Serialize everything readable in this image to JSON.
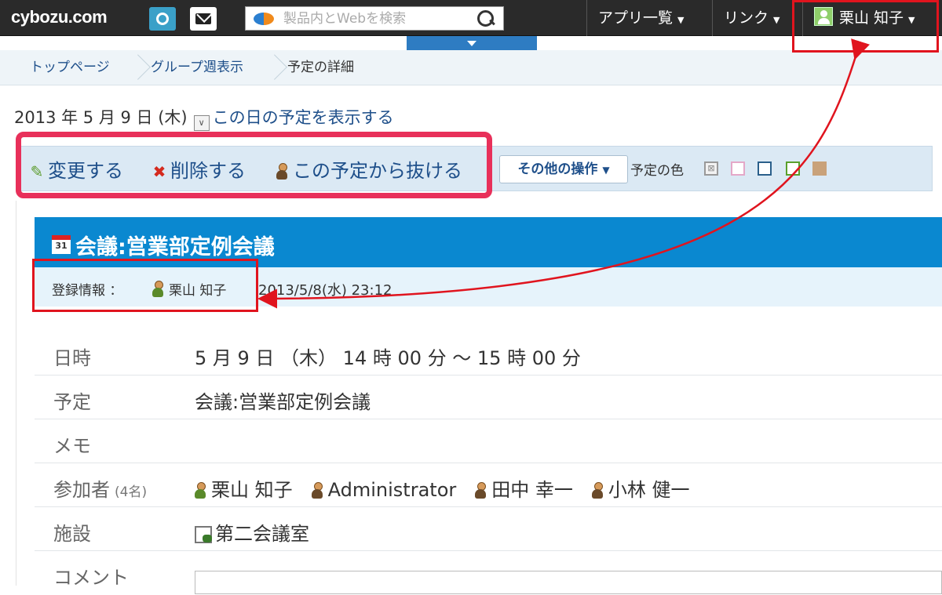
{
  "topbar": {
    "logo": "cybozu.com",
    "search_placeholder": "製品内とWebを検索",
    "nav_apps": "アプリ一覧",
    "nav_links": "リンク",
    "user_name": "栗山 知子"
  },
  "breadcrumb": {
    "items": [
      "トップページ",
      "グループ週表示",
      "予定の詳細"
    ]
  },
  "date_header": {
    "date": "2013 年 5 月 9 日 (木)",
    "show_day_link": "この日の予定を表示する"
  },
  "toolbar": {
    "edit": "変更する",
    "delete": "削除する",
    "leave": "この予定から抜ける",
    "other_ops": "その他の操作",
    "color_label": "予定の色",
    "colors": [
      "#e4a8c8",
      "#2a5f8a",
      "#5aa02c",
      "#c9a27a"
    ]
  },
  "schedule": {
    "title": "会議:営業部定例会議",
    "calendar_icon_text": "31",
    "registration_label": "登録情報 ：",
    "registrant": "栗山 知子",
    "registered_at": "2013/5/8(水) 23:12",
    "fields": {
      "datetime_label": "日時",
      "datetime_value": "5 月 9 日 （木） 14 時 00 分 ～ 15 時 00 分",
      "plan_label": "予定",
      "plan_value": "会議:営業部定例会議",
      "memo_label": "メモ",
      "memo_value": "",
      "participants_label": "参加者",
      "participants_count": "(4名)",
      "participants": [
        "栗山 知子",
        "Administrator",
        "田中 幸一",
        "小林 健一"
      ],
      "facility_label": "施設",
      "facility_value": "第二会議室",
      "comment_label": "コメント"
    }
  },
  "colors": {
    "topbar_bg": "#2a2a2a",
    "title_bar": "#0a88d0",
    "link": "#1e4f8a",
    "highlight_pink": "#e8305a",
    "highlight_red": "#e0141e"
  }
}
